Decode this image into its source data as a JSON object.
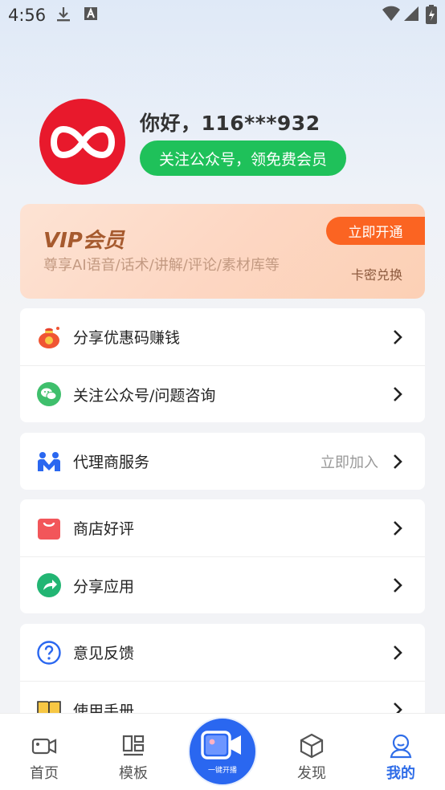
{
  "status_bar": {
    "time": "4:56"
  },
  "profile": {
    "greeting": "你好，116***932",
    "follow_button": "关注公众号，领免费会员"
  },
  "vip": {
    "title": "VIP会员",
    "description": "尊享AI语音/话术/讲解/评论/素材库等",
    "open_button": "立即开通",
    "redeem_link": "卡密兑换"
  },
  "menu": {
    "share_coupon": "分享优惠码赚钱",
    "follow_account": "关注公众号/问题咨询",
    "agent_service": "代理商服务",
    "agent_join": "立即加入",
    "store_review": "商店好评",
    "share_app": "分享应用",
    "feedback": "意见反馈",
    "manual": "使用手册"
  },
  "tabbar": {
    "home": "首页",
    "template": "模板",
    "center": "一键开播",
    "discover": "发现",
    "mine": "我的"
  },
  "colors": {
    "brand_blue": "#2a67f0",
    "follow_green": "#1fc15a",
    "vip_orange": "#fb6422",
    "avatar_red": "#e8192c"
  }
}
